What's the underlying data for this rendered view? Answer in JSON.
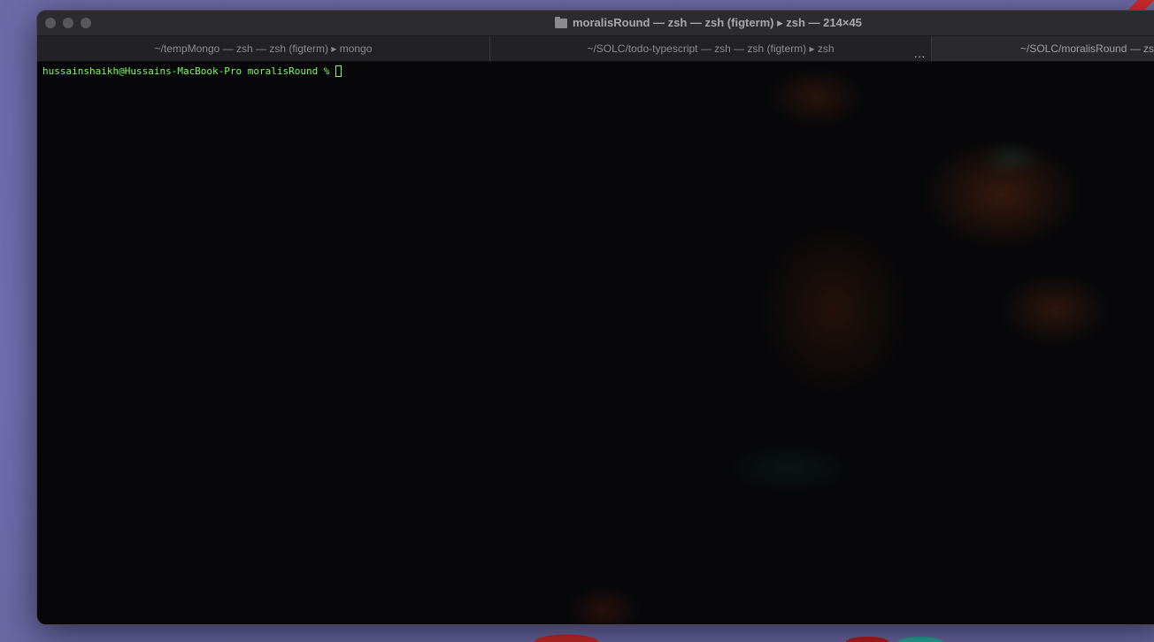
{
  "window": {
    "title": "moralisRound — zsh — zsh (figterm) ▸ zsh — 214×45"
  },
  "tabs": [
    {
      "label": "~/tempMongo — zsh — zsh (figterm) ▸ mongo"
    },
    {
      "label": "~/SOLC/todo-typescript — zsh — zsh (figterm) ▸ zsh",
      "more": "..."
    },
    {
      "label": "~/SOLC/moralisRound — zsh"
    }
  ],
  "terminal": {
    "prompt": "hussainshaikh@Hussains-MacBook-Pro moralisRound %",
    "text_color": "#7cfc5a",
    "background": "#070709"
  }
}
